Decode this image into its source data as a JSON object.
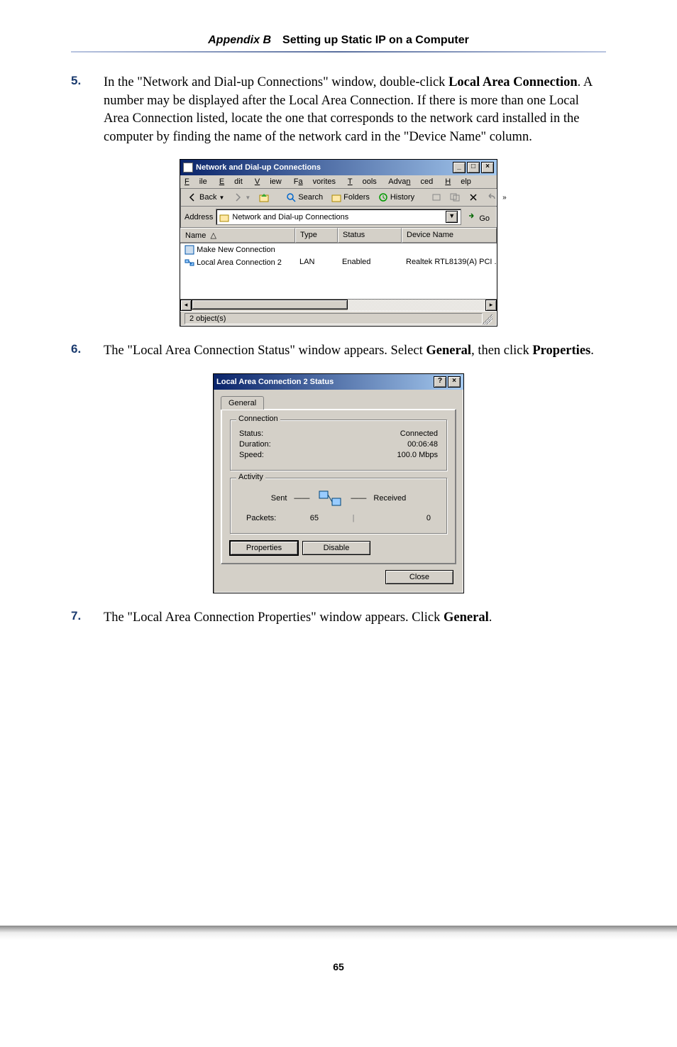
{
  "header": {
    "prefix": "Appendix B",
    "title": "Setting up Static IP on a Computer"
  },
  "steps": {
    "s5": {
      "num": "5.",
      "text_a": "In the \"Network and Dial-up Connections\" window, double-click ",
      "bold_a": "Local Area Connection",
      "text_b": ". A number may be displayed after the Local Area Connection. If there is more than one Local Area Connection listed, locate the one that corresponds to the network card installed in the computer by finding the name of the network card in the \"Device Name\" column."
    },
    "s6": {
      "num": "6.",
      "text_a": "The \"Local Area Connection Status\" window appears. Select ",
      "bold_a": "General",
      "text_b": ", then click ",
      "bold_b": "Properties",
      "text_c": "."
    },
    "s7": {
      "num": "7.",
      "text_a": "The \"Local Area Connection Properties\" window appears. Click ",
      "bold_a": "General",
      "text_b": "."
    }
  },
  "win1": {
    "title": "Network and Dial-up Connections",
    "menus": [
      "File",
      "Edit",
      "View",
      "Favorites",
      "Tools",
      "Advanced",
      "Help"
    ],
    "toolbar": {
      "back": "Back",
      "search": "Search",
      "folders": "Folders",
      "history": "History"
    },
    "address_label": "Address",
    "address_value": "Network and Dial-up Connections",
    "go": "Go",
    "columns": {
      "name": "Name",
      "type": "Type",
      "status": "Status",
      "device": "Device Name"
    },
    "rows": [
      {
        "name": "Make New Connection",
        "type": "",
        "status": "",
        "device": ""
      },
      {
        "name": "Local Area Connection 2",
        "type": "LAN",
        "status": "Enabled",
        "device": "Realtek RTL8139(A) PCI ..."
      }
    ],
    "statusbar": "2 object(s)"
  },
  "dlg": {
    "title": "Local Area Connection 2 Status",
    "tab": "General",
    "group_conn": "Connection",
    "status_label": "Status:",
    "status_value": "Connected",
    "duration_label": "Duration:",
    "duration_value": "00:06:48",
    "speed_label": "Speed:",
    "speed_value": "100.0 Mbps",
    "group_act": "Activity",
    "sent": "Sent",
    "received": "Received",
    "packets_label": "Packets:",
    "packets_sent": "65",
    "packets_recv": "0",
    "btn_props": "Properties",
    "btn_disable": "Disable",
    "btn_close": "Close"
  },
  "page_number": "65"
}
